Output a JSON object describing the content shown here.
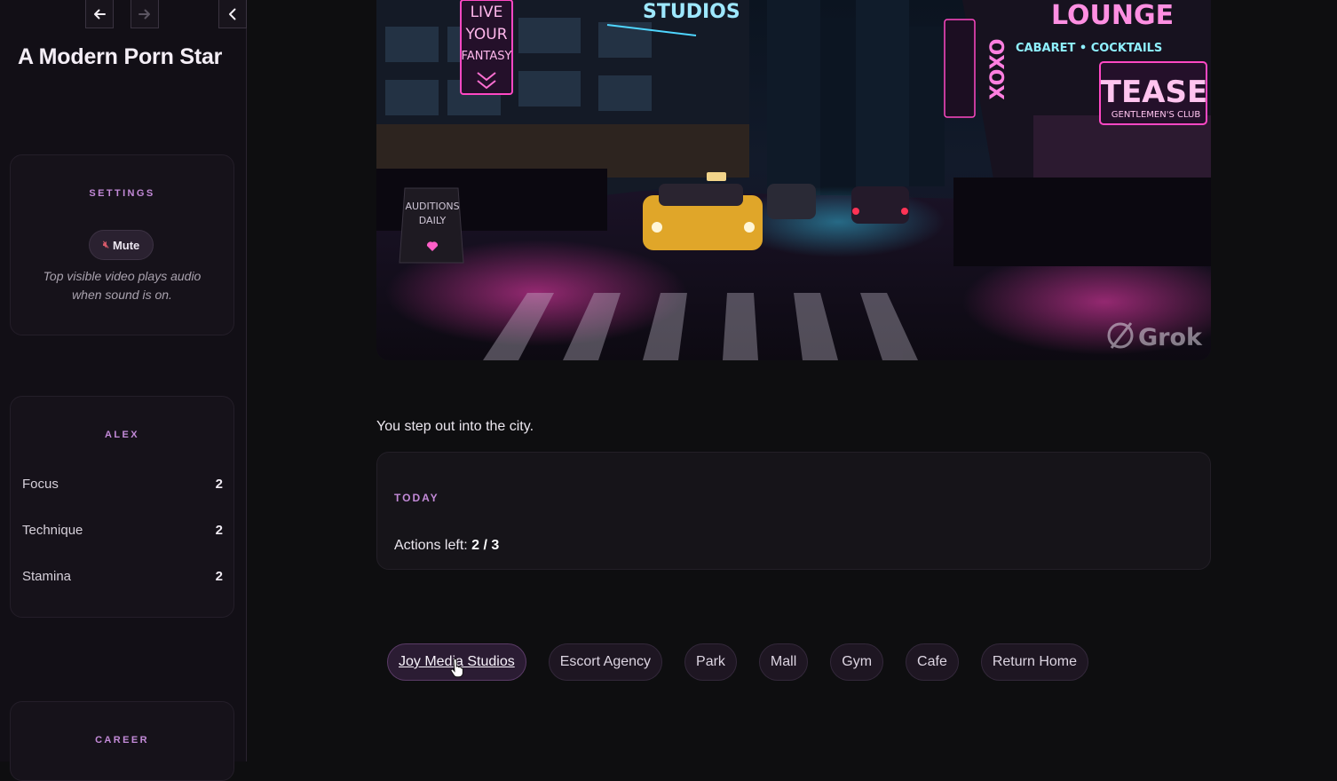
{
  "sidebar": {
    "title": "A Modern Porn Star",
    "nav": {
      "back_icon": "arrow-left-icon",
      "forward_icon": "arrow-right-icon",
      "collapse_icon": "chevron-left-icon"
    },
    "settings": {
      "title": "SETTINGS",
      "mute_icon": "speaker-muted-icon",
      "mute_label": "Mute",
      "help_text": "Top visible video plays audio when sound is on."
    },
    "character": {
      "title": "ALEX",
      "stats": [
        {
          "label": "Focus",
          "value": "2"
        },
        {
          "label": "Technique",
          "value": "2"
        },
        {
          "label": "Stamina",
          "value": "2"
        }
      ]
    },
    "career": {
      "title": "CAREER"
    }
  },
  "main": {
    "hero_image": {
      "description_icon": "city-night-image",
      "signs": [
        "LIVE",
        "YOUR",
        "FANTASY",
        "LOUNGE",
        "CABARET • COCKTAILS",
        "TEASE",
        "GENTLEMEN'S CLUB",
        "XOXO",
        "AUDITIONS",
        "DAILY",
        "STUDIOS"
      ],
      "watermark": "Grok"
    },
    "narration": "You step out into the city.",
    "today": {
      "title": "TODAY",
      "actions_label": "Actions left:",
      "actions_value": "2 / 3"
    },
    "choices": [
      {
        "label": "Joy Media Studios",
        "active": true
      },
      {
        "label": "Escort Agency"
      },
      {
        "label": "Park"
      },
      {
        "label": "Mall"
      },
      {
        "label": "Gym"
      },
      {
        "label": "Cafe"
      },
      {
        "label": "Return Home"
      }
    ]
  },
  "colors": {
    "accent": "#c38ad8",
    "background": "#0e0e10",
    "neon_pink": "#ff3fb8",
    "neon_cyan": "#38d6ff"
  }
}
